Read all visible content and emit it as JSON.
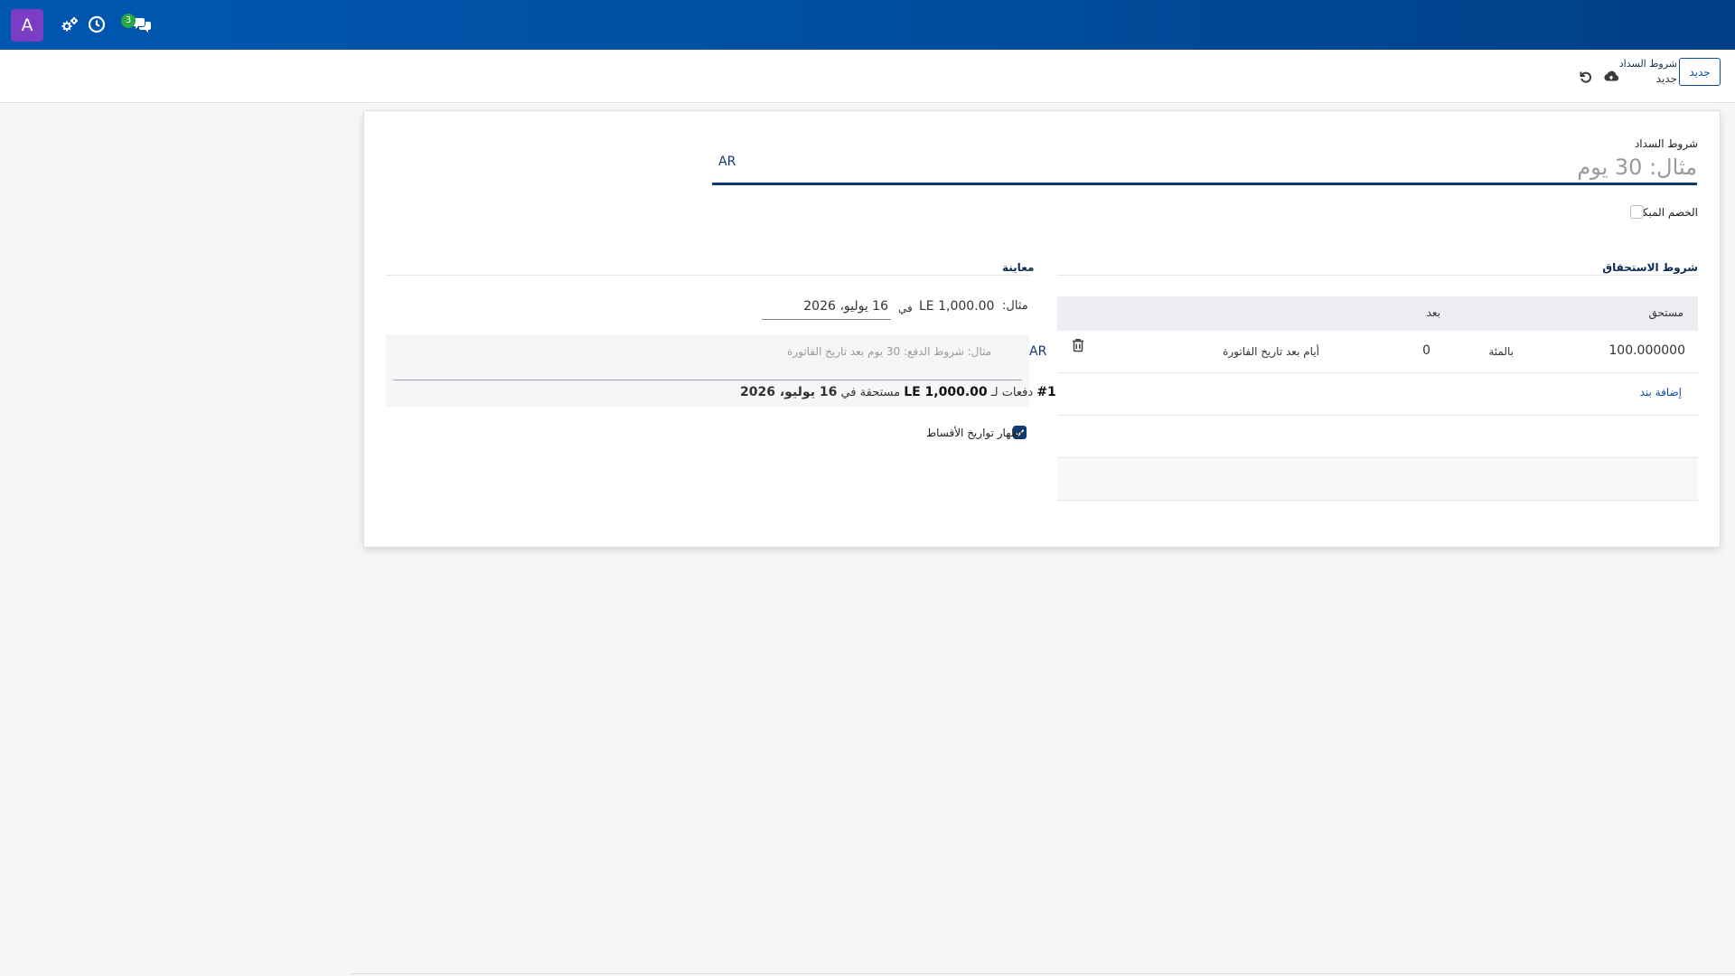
{
  "navbar": {
    "avatar_letter": "A",
    "chat_badge_count": "3",
    "icons": [
      "settings-gears-icon",
      "activity-clock-icon",
      "discuss-chat-icon"
    ],
    "background_color": "#004d9e"
  },
  "control_panel": {
    "new_button_label": "جديد",
    "breadcrumb_parent": "شروط السداد",
    "breadcrumb_current": "جديد",
    "icons": [
      "cloud-upload-icon",
      "discard-undo-icon"
    ]
  },
  "form": {
    "name_label": "شروط السداد",
    "name_placeholder": "مثال: 30 يوم",
    "name_value": "",
    "lang_code": "AR",
    "early_discount_label": "الخصم المبكر",
    "early_discount_checked": false,
    "due_terms": {
      "title": "شروط الاستحقاق",
      "columns": [
        "مستحق",
        "بعد"
      ],
      "rows": [
        {
          "value": "100.000000",
          "type": "بالمئة",
          "after": "0",
          "delay": "أيام بعد تاريخ الفاتورة"
        }
      ],
      "add_line_label": "إضافة بند"
    },
    "preview": {
      "title": "معاينة",
      "example_label": "مثال:",
      "example_amount": "LE 1,000.00",
      "example_in": "في",
      "example_date": "16 يوليو، 2026",
      "note_placeholder": "مثال: شروط الدفع: 30 يوم بعد تاريخ الفاتورة",
      "note_lang": "AR",
      "payment_prefix": "#1",
      "payment_text": "دفعات لـ",
      "payment_amount": "LE 1,000.00",
      "payment_due_text": "مستحقة في",
      "payment_date": "16 يوليو، 2026",
      "show_installments_label": "إظهار تواريخ الأقساط",
      "show_installments_checked": true
    }
  },
  "colors": {
    "primary": "#0d3c73",
    "link": "#0d4f9e",
    "avatar": "#7a3dc4",
    "badge": "#28a745"
  }
}
